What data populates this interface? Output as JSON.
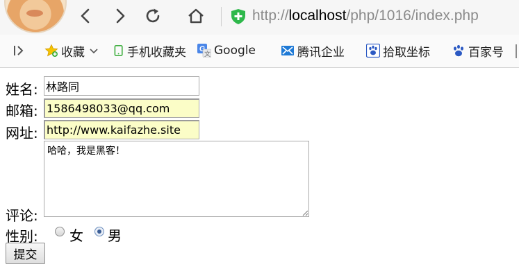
{
  "browser": {
    "url_prefix": "http://",
    "url_host": "localhost",
    "url_path": "/php/1016/index.php",
    "bookmarks": [
      {
        "label": "收藏",
        "icon": "star-icon"
      },
      {
        "label": "手机收藏夹",
        "icon": "phone-icon"
      },
      {
        "label": "Google",
        "icon": "google-translate-icon"
      },
      {
        "label": "腾讯企业",
        "icon": "tencent-mail-icon"
      },
      {
        "label": "拾取坐标",
        "icon": "baidu-paw-icon"
      },
      {
        "label": "百家号",
        "icon": "baidu-paw-icon"
      }
    ]
  },
  "form": {
    "name_label": "姓名:",
    "name_value": "林路同",
    "email_label": "邮箱:",
    "email_value": "1586498033@qq.com",
    "website_label": "网址:",
    "website_value": "http://www.kaifazhe.site",
    "comment_label": "评论:",
    "comment_value": "哈哈，我是黑客！",
    "gender_label": "性别:",
    "gender_options": [
      {
        "label": "女",
        "checked": false
      },
      {
        "label": "男",
        "checked": true
      }
    ],
    "submit_label": "提交"
  },
  "colors": {
    "autofill_bg": "#fbfdc7",
    "shield_green": "#2eb84b",
    "radio_checked": "#3c5f96"
  }
}
